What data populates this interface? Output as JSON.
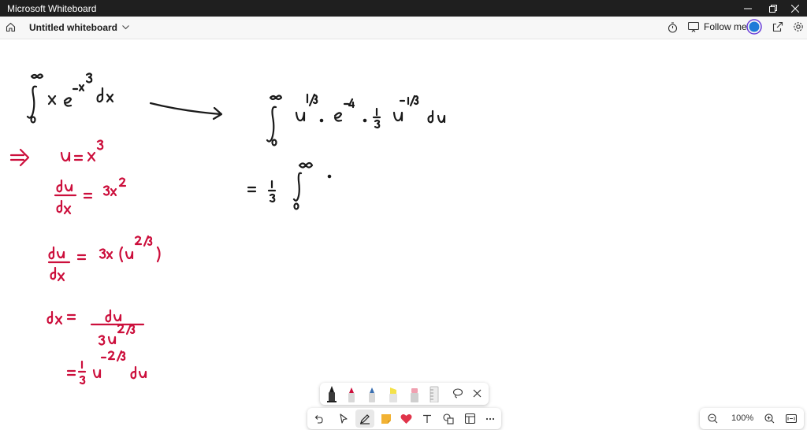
{
  "window": {
    "title": "Microsoft Whiteboard"
  },
  "toolbar": {
    "board_title": "Untitled whiteboard",
    "follow_label": "Follow me"
  },
  "zoom": {
    "level": "100%"
  },
  "colors": {
    "ink_black": "#1a1a1a",
    "ink_red": "#cc0f3c",
    "avatar_blue": "#1e7bd8",
    "avatar_ring": "#6b3fd9"
  },
  "icons": {
    "home": "home-icon",
    "timer": "timer-icon",
    "cast": "cast-icon",
    "share": "share-icon",
    "settings": "gear-icon"
  }
}
